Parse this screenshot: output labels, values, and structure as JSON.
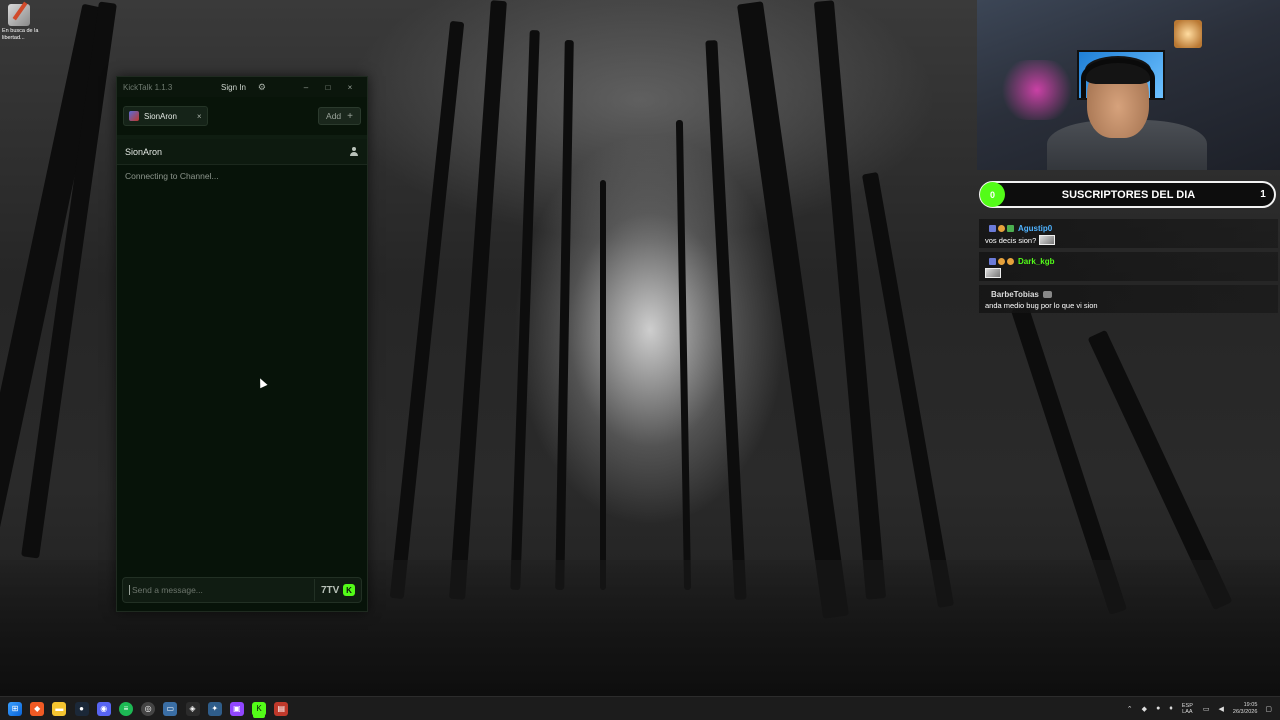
{
  "desktop": {
    "icon_label": "En busca de la libertad..."
  },
  "kicktalk": {
    "app_title": "KickTalk 1.1.3",
    "sign_in": "Sign In",
    "settings_icon": "gear-icon",
    "min": "–",
    "max": "□",
    "close": "×",
    "tab": {
      "name": "SionAron",
      "close": "×"
    },
    "add_label": "Add",
    "add_plus": "+",
    "channel_name": "SionAron",
    "status": "Connecting to Channel...",
    "input_placeholder": "Send a message...",
    "emote_icon_label": "7TV",
    "kick_icon_label": "K"
  },
  "overlay": {
    "subs": {
      "left_count": "0",
      "title": "SUSCRIPTORES DEL DIA",
      "right_count": "1"
    },
    "chat": [
      {
        "user": "Agustip0",
        "color": "#4fb3ff",
        "text": "vos decis sion?"
      },
      {
        "user": "Dark_kgb",
        "color": "#53fc18",
        "text": ""
      },
      {
        "user": "BarbeTobias",
        "color": "#dddddd",
        "text": "anda medio bug por lo que vi sion"
      }
    ]
  },
  "taskbar": {
    "icons": [
      "windows-start-icon",
      "brave-icon",
      "file-explorer-icon",
      "steam-icon",
      "discord-icon",
      "spotify-icon",
      "chrome-icon",
      "vpn-icon",
      "app-icon",
      "game-icon",
      "twitch-icon",
      "kicktalk-icon",
      "recorder-icon"
    ],
    "lang_top": "ESP",
    "lang_bottom": "LAA",
    "time": "19:05",
    "date": "26/3/2026"
  },
  "colors": {
    "kick_green": "#53fc18",
    "window_bg": "#071309"
  }
}
